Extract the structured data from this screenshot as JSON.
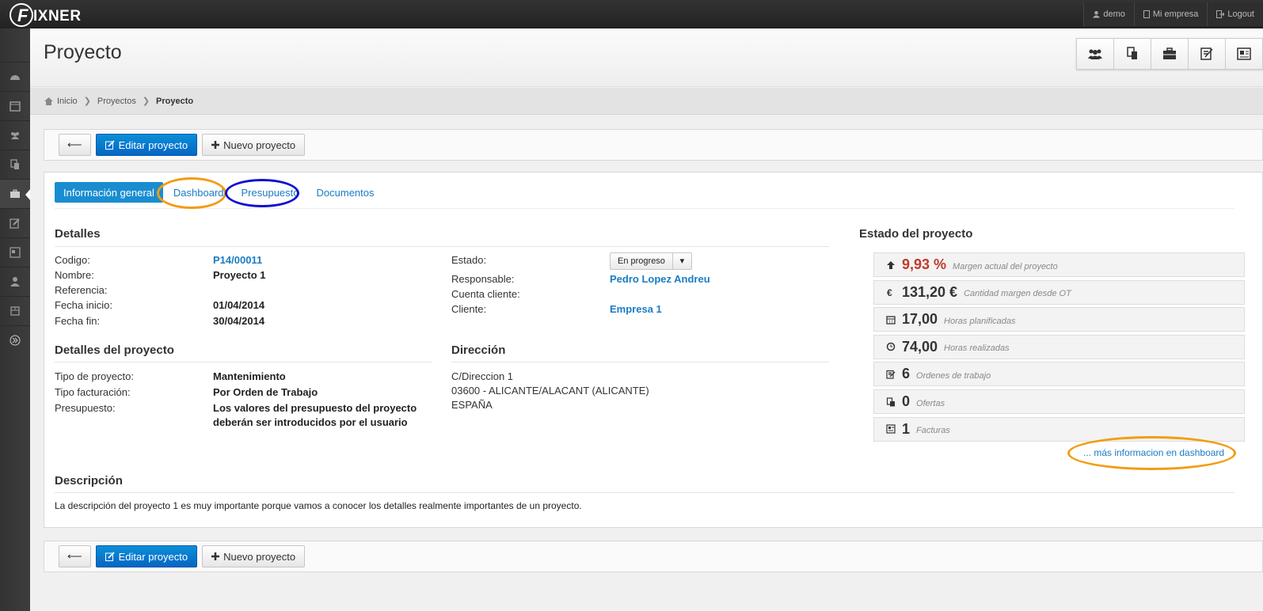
{
  "app": {
    "logo_text": "IXNER",
    "logo_letter": "F"
  },
  "topnav": [
    {
      "label": "demo"
    },
    {
      "label": "Mi empresa"
    },
    {
      "label": "Logout"
    }
  ],
  "sidebar": {
    "items": [
      "dashboard-icon",
      "calendar-icon",
      "people-icon",
      "documents-icon",
      "briefcase-icon",
      "edit-icon",
      "contact-card-icon",
      "user-icon",
      "box-icon",
      "expand-icon"
    ]
  },
  "page": {
    "title": "Proyecto"
  },
  "quick_actions": [
    "people-icon",
    "documents-icon",
    "briefcase-icon",
    "edit-icon",
    "contact-card-icon"
  ],
  "breadcrumb": {
    "home": "Inicio",
    "level1": "Proyectos",
    "current": "Proyecto"
  },
  "toolbar": {
    "back_label": "⟵",
    "edit_label": "Editar proyecto",
    "new_label": "Nuevo proyecto"
  },
  "tabs": [
    {
      "label": "Información general"
    },
    {
      "label": "Dashboard"
    },
    {
      "label": "Presupuesto"
    },
    {
      "label": "Documentos"
    }
  ],
  "detalles": {
    "title": "Detalles",
    "codigo_k": "Codigo:",
    "codigo_v": "P14/00011",
    "nombre_k": "Nombre:",
    "nombre_v": "Proyecto 1",
    "referencia_k": "Referencia:",
    "inicio_k": "Fecha inicio:",
    "inicio_v": "01/04/2014",
    "fin_k": "Fecha fin:",
    "fin_v": "30/04/2014",
    "estado_k": "Estado:",
    "estado_v": "En progreso",
    "responsable_k": "Responsable:",
    "responsable_v": "Pedro Lopez Andreu",
    "cuenta_k": "Cuenta cliente:",
    "cliente_k": "Cliente:",
    "cliente_v": "Empresa 1"
  },
  "detalles_proyecto": {
    "title": "Detalles del proyecto",
    "tipo_k": "Tipo de proyecto:",
    "tipo_v": "Mantenimiento",
    "fact_k": "Tipo facturación:",
    "fact_v": "Por Orden de Trabajo",
    "pres_k": "Presupuesto:",
    "pres_v1": "Los valores del presupuesto del proyecto",
    "pres_v2": "deberán ser introducidos por el usuario"
  },
  "direccion": {
    "title": "Dirección",
    "line1": "C/Direccion 1",
    "line2": "03600 - ALICANTE/ALACANT (ALICANTE)",
    "line3": "ESPAÑA"
  },
  "estado": {
    "title": "Estado del proyecto",
    "stats": [
      {
        "icon": "arrow-up-icon",
        "value": "9,93 %",
        "label": "Margen actual del proyecto",
        "color": "#c0392b"
      },
      {
        "icon": "euro-icon",
        "value": "131,20 €",
        "label": "Cantidad margen desde OT"
      },
      {
        "icon": "calendar-icon",
        "value": "17,00",
        "label": "Horas planificadas"
      },
      {
        "icon": "clock-icon",
        "value": "74,00",
        "label": "Horas realizadas"
      },
      {
        "icon": "edit-icon",
        "value": "6",
        "label": "Ordenes de trabajo"
      },
      {
        "icon": "documents-icon",
        "value": "0",
        "label": "Ofertas"
      },
      {
        "icon": "contact-card-icon",
        "value": "1",
        "label": "Facturas"
      }
    ],
    "more_link": "... más informacion en dashboard"
  },
  "descripcion": {
    "title": "Descripción",
    "text": "La descripción del proyecto 1 es muy importante porque vamos a conocer los detalles realmente importantes de un proyecto."
  },
  "colors": {
    "accent": "#1a8dd0",
    "highlight_orange": "#f39c12",
    "highlight_blue": "#1010d0",
    "red": "#c0392b"
  }
}
